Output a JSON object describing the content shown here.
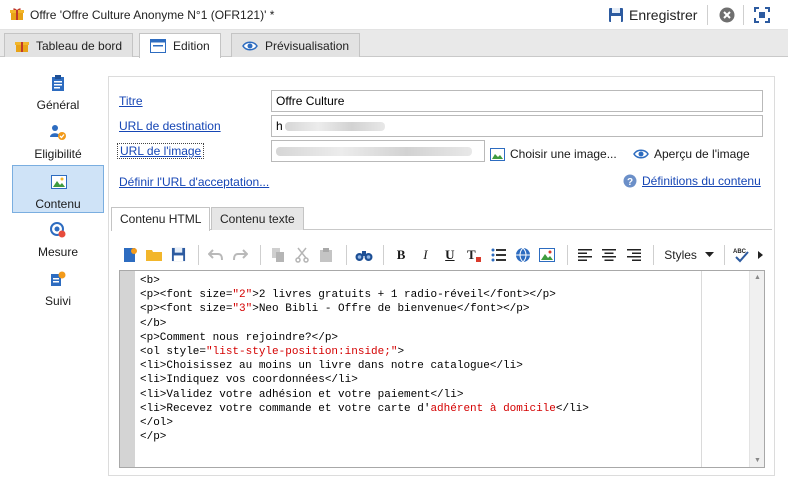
{
  "window": {
    "title": "Offre 'Offre Culture Anonyme N°1 (OFR121)' *",
    "save_label": "Enregistrer"
  },
  "tabs": [
    {
      "label": "Tableau de bord"
    },
    {
      "label": "Edition"
    },
    {
      "label": "Prévisualisation"
    }
  ],
  "sidebar": {
    "items": [
      {
        "label": "Général"
      },
      {
        "label": "Eligibilité"
      },
      {
        "label": "Contenu"
      },
      {
        "label": "Mesure"
      },
      {
        "label": "Suivi"
      }
    ]
  },
  "form": {
    "titre_label": "Titre",
    "titre_value": "Offre Culture",
    "url_dest_label": "URL de destination",
    "url_dest_value": "h",
    "url_image_label": "URL de l'image",
    "url_image_value": "",
    "choose_image_label": "Choisir une image...",
    "preview_image_label": "Aperçu de l'image",
    "accept_url_label": "Définir l'URL d'acceptation...",
    "content_defs_label": "Définitions du contenu"
  },
  "content_tabs": [
    {
      "label": "Contenu HTML"
    },
    {
      "label": "Contenu texte"
    }
  ],
  "toolbar": {
    "bold": "B",
    "italic": "I",
    "underline": "U",
    "styles_label": "Styles"
  },
  "editor": {
    "lines": [
      [
        {
          "t": "<b>"
        }
      ],
      [
        {
          "t": "<p><font size="
        },
        {
          "t": "\"2\"",
          "v": true
        },
        {
          "t": ">2 livres gratuits + 1 radio-réveil</font></p>"
        }
      ],
      [
        {
          "t": "<p><font size="
        },
        {
          "t": "\"3\"",
          "v": true
        },
        {
          "t": ">Neo Bibli - Offre de bienvenue</font></p>"
        }
      ],
      [
        {
          "t": "</b>"
        }
      ],
      [
        {
          "t": "<p>Comment nous rejoindre?</p>"
        }
      ],
      [
        {
          "t": "<ol style="
        },
        {
          "t": "\"list-style-position:inside;\"",
          "v": true
        },
        {
          "t": ">"
        }
      ],
      [
        {
          "t": "<li>Choisissez au moins un livre dans notre catalogue</li>"
        }
      ],
      [
        {
          "t": "<li>Indiquez vos coordonnées</li>"
        }
      ],
      [
        {
          "t": "<li>Validez votre adhésion et votre paiement</li>"
        }
      ],
      [
        {
          "t": "<li>Recevez votre commande et votre carte d'"
        },
        {
          "t": "adhérent à domicile",
          "v": true
        },
        {
          "t": "</li>"
        }
      ],
      [
        {
          "t": "</ol>"
        }
      ],
      [
        {
          "t": "</p>"
        }
      ]
    ]
  },
  "colors": {
    "link": "#1646b5",
    "active_sidebar": "#cfe3f7",
    "code_value": "#d40000"
  }
}
